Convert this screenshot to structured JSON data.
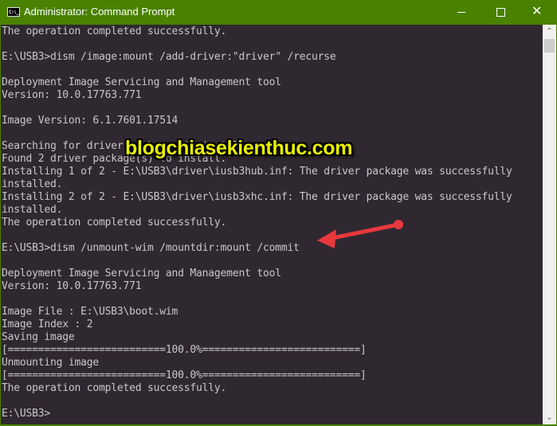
{
  "window": {
    "title": "Administrator: Command Prompt",
    "app_icon": "cmd-icon",
    "app_icon_text": "C:\\_",
    "controls": {
      "minimize": "minimize-icon",
      "maximize": "maximize-icon",
      "close": "close-icon",
      "close_glyph": "✕"
    }
  },
  "console": {
    "lines": [
      "The operation completed successfully.",
      "",
      "E:\\USB3>dism /image:mount /add-driver:\"driver\" /recurse",
      "",
      "Deployment Image Servicing and Management tool",
      "Version: 10.0.17763.771",
      "",
      "Image Version: 6.1.7601.17514",
      "",
      "Searching for driver packages to install...",
      "Found 2 driver package(s) to install.",
      "Installing 1 of 2 - E:\\USB3\\driver\\iusb3hub.inf: The driver package was successfully",
      "installed.",
      "Installing 2 of 2 - E:\\USB3\\driver\\iusb3xhc.inf: The driver package was successfully",
      "installed.",
      "The operation completed successfully.",
      "",
      "E:\\USB3>dism /unmount-wim /mountdir:mount /commit",
      "",
      "Deployment Image Servicing and Management tool",
      "Version: 10.0.17763.771",
      "",
      "Image File : E:\\USB3\\boot.wim",
      "Image Index : 2",
      "Saving image",
      "[==========================100.0%==========================]",
      "Unmounting image",
      "[==========================100.0%==========================]",
      "The operation completed successfully.",
      "",
      "E:\\USB3>"
    ],
    "progress": {
      "saving_image_percent": 100.0,
      "unmounting_image_percent": 100.0
    }
  },
  "scrollbar": {
    "up_glyph": "⌃",
    "down_glyph": "⌄"
  },
  "overlay": {
    "watermark": "blogchiasekienthuc.com",
    "annotation_arrow": "red-arrow pointing to unmount command",
    "arrow_color": "#e8383d",
    "watermark_color": "#e8f000"
  },
  "colors": {
    "titlebar": "#4a8200",
    "console_bg": "#302830",
    "console_text": "#c8c8c8"
  }
}
